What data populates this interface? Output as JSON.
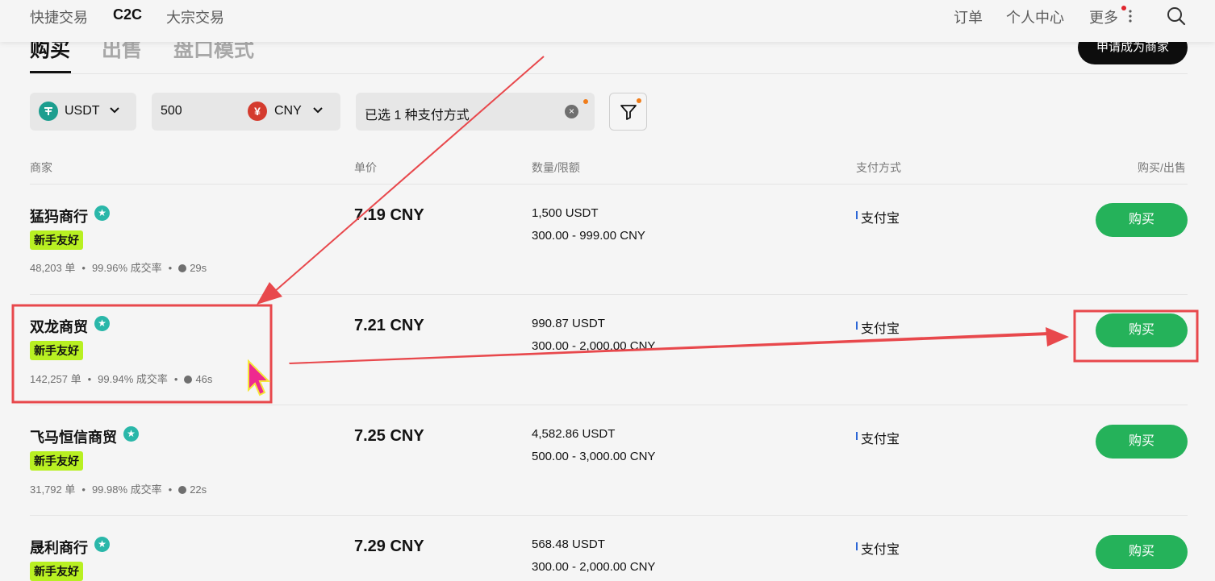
{
  "nav": {
    "left": [
      "快捷交易",
      "C2C",
      "大宗交易"
    ],
    "right": [
      "订单",
      "个人中心",
      "更多"
    ]
  },
  "tabs": [
    "购买",
    "出售",
    "盘口模式"
  ],
  "merchant_button": "申请成为商家",
  "filters": {
    "crypto": "USDT",
    "amount": "500",
    "fiat": "CNY",
    "fiat_symbol": "¥",
    "payment": "已选 1 种支付方式"
  },
  "columns": [
    "商家",
    "单价",
    "数量/限额",
    "支付方式",
    "购买/出售"
  ],
  "rows": [
    {
      "name": "猛犸商行",
      "tag": "新手友好",
      "orders": "48,203 单",
      "rate": "99.96% 成交率",
      "time": "29s",
      "price": "7.19 CNY",
      "qty": "1,500 USDT",
      "limit": "300.00 - 999.00 CNY",
      "pay": "支付宝",
      "action": "购买"
    },
    {
      "name": "双龙商贸",
      "tag": "新手友好",
      "orders": "142,257 单",
      "rate": "99.94% 成交率",
      "time": "46s",
      "price": "7.21 CNY",
      "qty": "990.87 USDT",
      "limit": "300.00 - 2,000.00 CNY",
      "pay": "支付宝",
      "action": "购买"
    },
    {
      "name": "飞马恒信商贸",
      "tag": "新手友好",
      "orders": "31,792 单",
      "rate": "99.98% 成交率",
      "time": "22s",
      "price": "7.25 CNY",
      "qty": "4,582.86 USDT",
      "limit": "500.00 - 3,000.00 CNY",
      "pay": "支付宝",
      "action": "购买"
    },
    {
      "name": "晟利商行",
      "tag": "新手友好",
      "orders": "",
      "rate": "",
      "time": "",
      "price": "7.29 CNY",
      "qty": "568.48 USDT",
      "limit": "300.00 - 2,000.00 CNY",
      "pay": "支付宝",
      "action": "购买"
    }
  ],
  "colors": {
    "accent_green": "#25b25a",
    "tag_lime": "#b8f022",
    "annotation_red": "#e8484c"
  }
}
